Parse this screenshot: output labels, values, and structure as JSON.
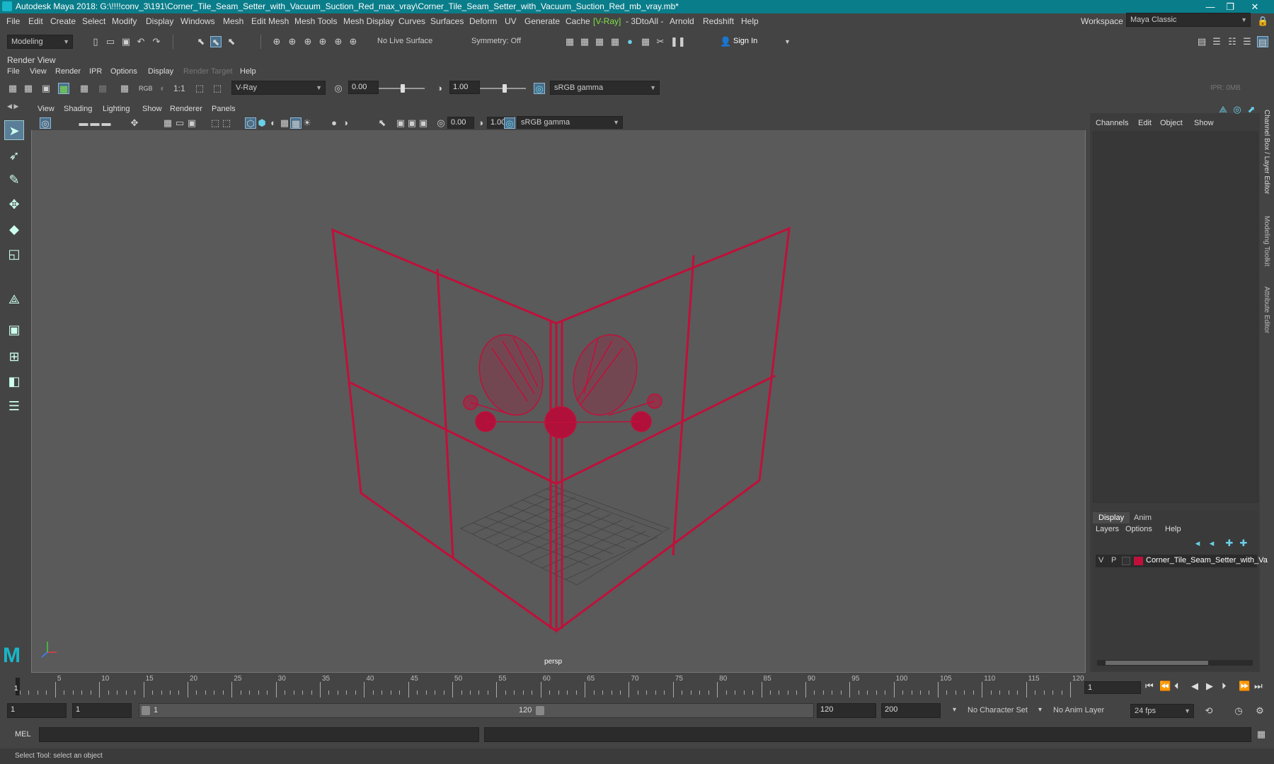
{
  "window": {
    "title": "Autodesk Maya 2018: G:\\!!!!conv_3\\191\\Corner_Tile_Seam_Setter_with_Vacuum_Suction_Red_max_vray\\Corner_Tile_Seam_Setter_with_Vacuum_Suction_Red_mb_vray.mb*",
    "minimize": "—",
    "maximize": "❐",
    "close": "✕"
  },
  "menubar": {
    "items": [
      "File",
      "Edit",
      "Create",
      "Select",
      "Modify",
      "Display",
      "Windows",
      "Mesh",
      "Edit Mesh",
      "Mesh Tools",
      "Mesh Display",
      "Curves",
      "Surfaces",
      "Deform",
      "UV",
      "Generate",
      "Cache",
      "[V-Ray]",
      "- 3DtoAll -",
      "Arnold",
      "Redshift",
      "Help"
    ],
    "workspace_label": "Workspace :",
    "workspace_value": "Maya Classic"
  },
  "shelf": {
    "mode": "Modeling",
    "live_surface": "No Live Surface",
    "symmetry": "Symmetry: Off",
    "sign_in": "Sign In"
  },
  "render_view": {
    "label": "Render View",
    "menu": [
      "File",
      "View",
      "Render",
      "IPR",
      "Options",
      "Display",
      "Render Target",
      "Help"
    ],
    "ratio": "1:1",
    "rgb": "RGB",
    "renderer": "V-Ray",
    "exposure": "0.00",
    "gamma": "1.00",
    "colorspace": "sRGB gamma",
    "ipr": "IPR: 0MB"
  },
  "viewport": {
    "menu": [
      "View",
      "Shading",
      "Lighting",
      "Show",
      "Renderer",
      "Panels"
    ],
    "exposure": "0.00",
    "gamma": "1.00",
    "colorspace": "sRGB gamma",
    "camera": "persp",
    "wire_color": "#c0103a"
  },
  "channel_box": {
    "menu": [
      "Channels",
      "Edit",
      "Object",
      "Show"
    ]
  },
  "side_tabs": [
    "Channel Box / Layer Editor",
    "Modeling Toolkit",
    "Attribute Editor"
  ],
  "layer_editor": {
    "tabs": [
      "Display",
      "Anim"
    ],
    "menu": [
      "Layers",
      "Options",
      "Help"
    ],
    "layer": {
      "v": "V",
      "p": "P",
      "name": "Corner_Tile_Seam_Setter_with_Va",
      "color": "#c0103a"
    }
  },
  "timeline": {
    "ticks": [
      "5",
      "10",
      "15",
      "20",
      "25",
      "30",
      "35",
      "40",
      "45",
      "50",
      "55",
      "60",
      "65",
      "70",
      "75",
      "80",
      "85",
      "90",
      "95",
      "100",
      "105",
      "110",
      "115",
      "120"
    ],
    "current_frame": "1",
    "frame_field": "1"
  },
  "range": {
    "start": "1",
    "start2": "1",
    "slider_start": "1",
    "slider_end": "120",
    "end": "120",
    "end2": "200",
    "character_set": "No Character Set",
    "anim_layer": "No Anim Layer",
    "fps": "24 fps"
  },
  "command": {
    "label": "MEL"
  },
  "help_line": "Select Tool: select an object"
}
